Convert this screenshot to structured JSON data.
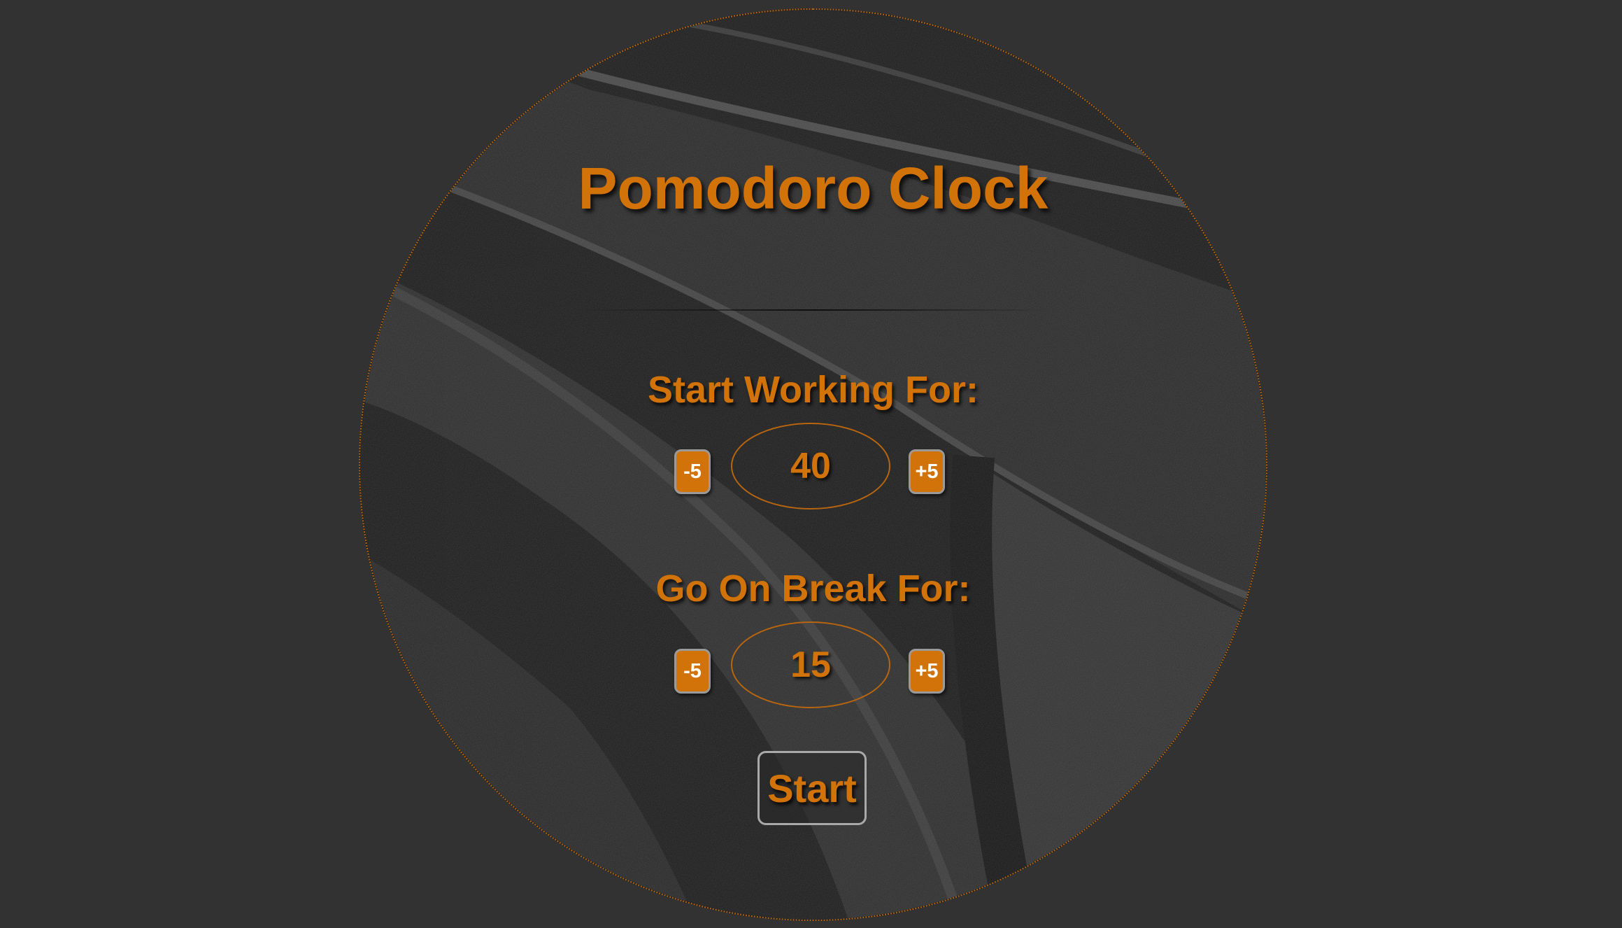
{
  "app": {
    "title": "Pomodoro Clock"
  },
  "work": {
    "label": "Start Working For:",
    "value": "40",
    "decrement_label": "-5",
    "increment_label": "+5"
  },
  "break": {
    "label": "Go On Break For:",
    "value": "15",
    "decrement_label": "-5",
    "increment_label": "+5"
  },
  "controls": {
    "start_label": "Start"
  },
  "colors": {
    "accent": "#d27309",
    "page_background": "#323232",
    "button_border": "#9a9a9a"
  }
}
